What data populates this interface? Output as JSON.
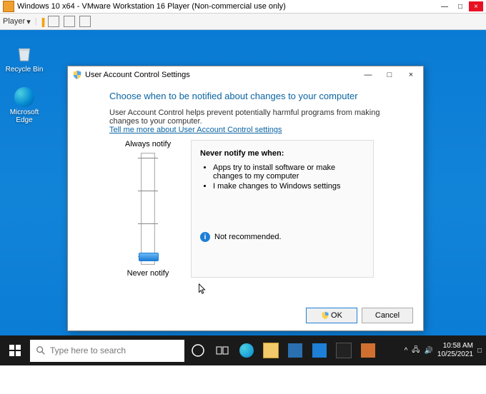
{
  "vmware": {
    "title": "Windows 10 x64 - VMware Workstation 16 Player (Non-commercial use only)",
    "player_label": "Player",
    "minimize": "—",
    "maximize": "□",
    "close": "×"
  },
  "desktop": {
    "recycle_bin": "Recycle Bin",
    "edge": "Microsoft Edge"
  },
  "uac": {
    "window_title": "User Account Control Settings",
    "heading": "Choose when to be notified about changes to your computer",
    "description": "User Account Control helps prevent potentially harmful programs from making changes to your computer.",
    "link": "Tell me more about User Account Control settings",
    "slider_top": "Always notify",
    "slider_bottom": "Never notify",
    "box_title": "Never notify me when:",
    "bullet1": "Apps try to install software or make changes to my computer",
    "bullet2": "I make changes to Windows settings",
    "not_recommended": "Not recommended.",
    "ok": "OK",
    "cancel": "Cancel",
    "win_min": "—",
    "win_max": "□",
    "win_close": "×"
  },
  "taskbar": {
    "search_placeholder": "Type here to search",
    "chevron": "^",
    "time": "10:58 AM",
    "date": "10/25/2021",
    "notif": "□"
  }
}
